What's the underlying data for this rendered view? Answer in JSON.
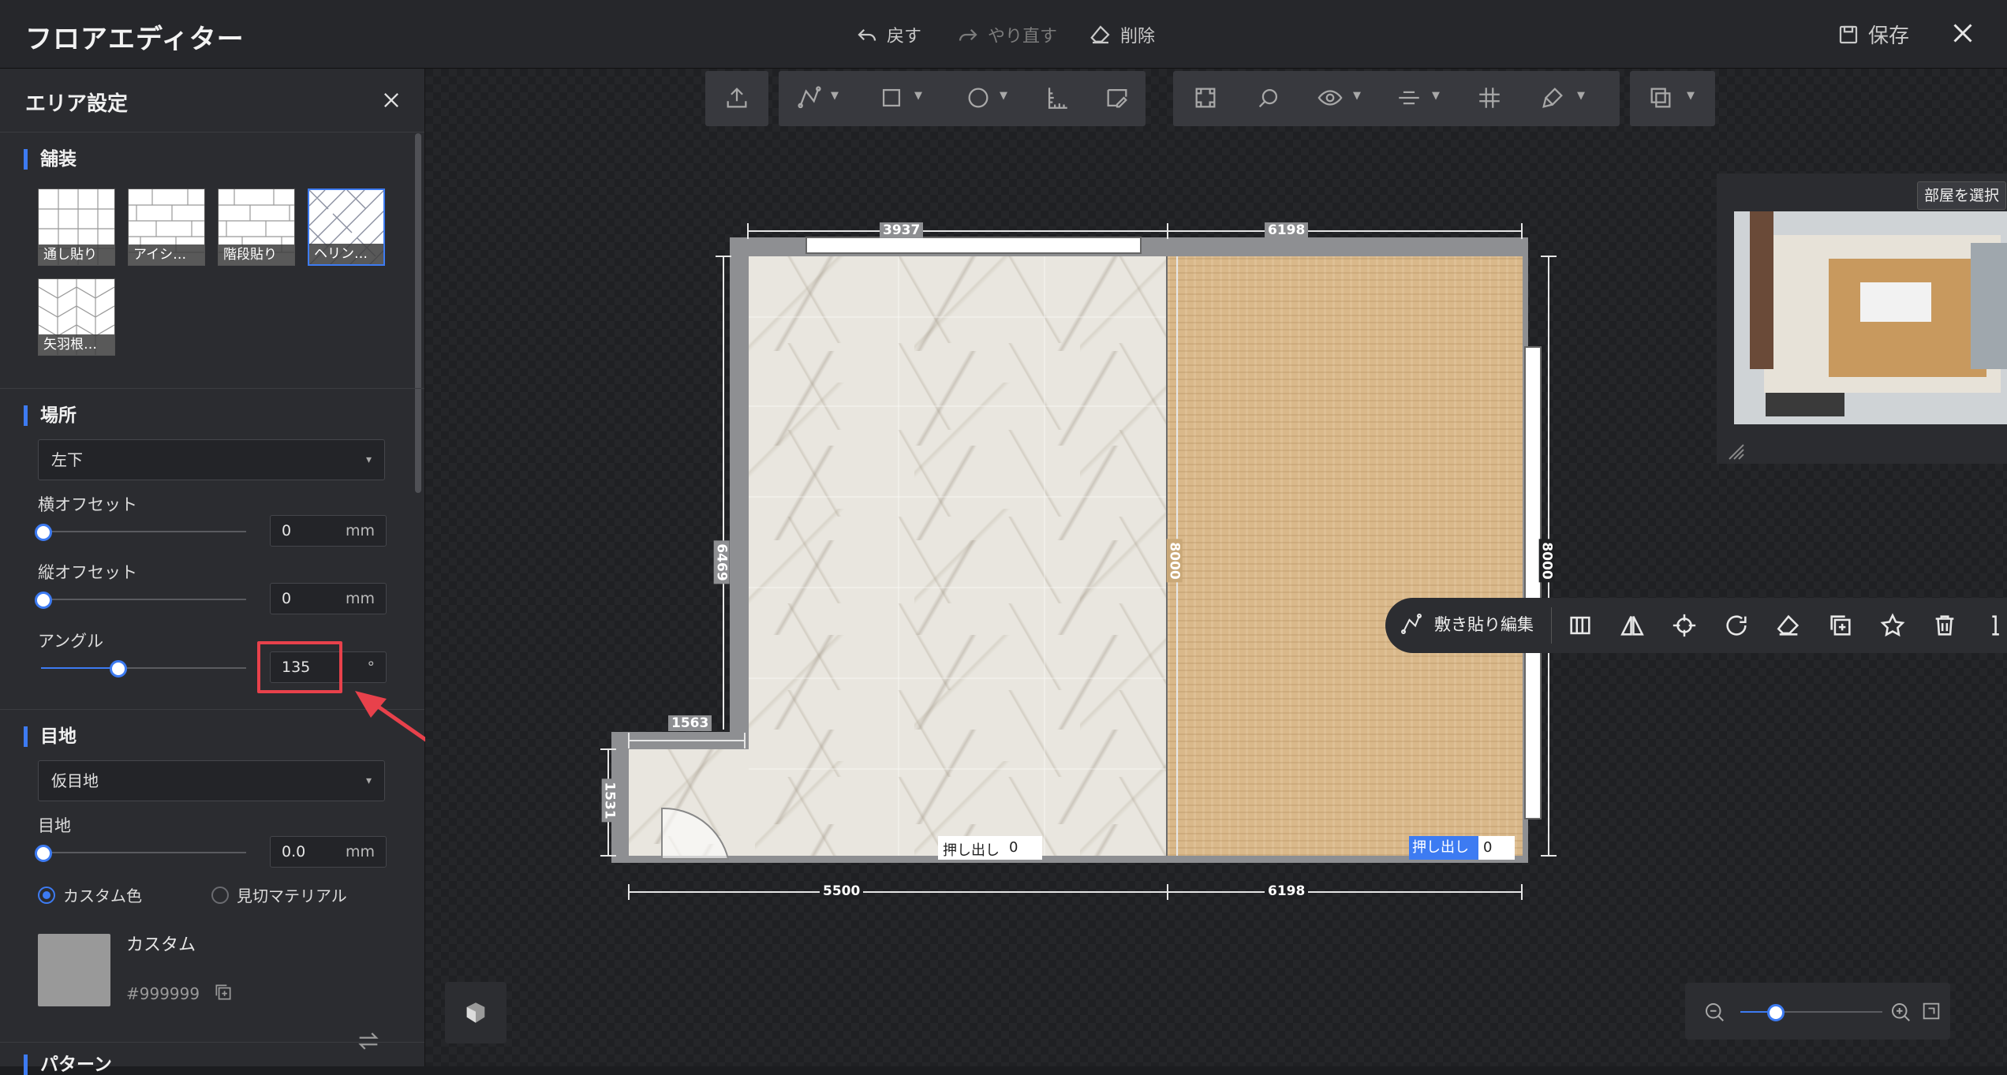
{
  "app": {
    "title": "フロアエディター"
  },
  "topbar": {
    "undo_label": "戻す",
    "redo_label": "やり直す",
    "delete_label": "削除",
    "save_label": "保存"
  },
  "panel": {
    "title": "エリア設定",
    "paving": {
      "section_title": "舗装",
      "patterns": [
        {
          "label": "通し貼り",
          "selected": false
        },
        {
          "label": "アイシ…",
          "selected": false
        },
        {
          "label": "階段貼り",
          "selected": false
        },
        {
          "label": "ヘリン…",
          "selected": true
        },
        {
          "label": "矢羽根…",
          "selected": false
        }
      ]
    },
    "location": {
      "section_title": "場所",
      "anchor_value": "左下",
      "h_offset_label": "横オフセット",
      "h_offset_value": "0",
      "h_offset_unit": "mm",
      "v_offset_label": "縦オフセット",
      "v_offset_value": "0",
      "v_offset_unit": "mm",
      "angle_label": "アングル",
      "angle_value": "135",
      "angle_unit": "°",
      "angle_fraction": 0.375
    },
    "joint": {
      "section_title": "目地",
      "type_value": "仮目地",
      "width_label": "目地",
      "width_value": "0.0",
      "width_unit": "mm",
      "color_mode_custom": "カスタム色",
      "color_mode_material": "見切マテリアル",
      "selected_mode": "custom",
      "swatch_name": "カスタム",
      "swatch_hex": "#999999"
    },
    "next_section_title": "パターン"
  },
  "canvas": {
    "tile_edit_label": "敷き貼り編集",
    "select_room_label": "部屋を選択",
    "extrude_label": "押し出し",
    "extrude_left_value": "0",
    "extrude_right_value": "0",
    "zoom_fraction": 0.25
  },
  "plan": {
    "dims": {
      "top_left": "3937",
      "top_right": "6198",
      "left_vertical": "6469",
      "middle_vertical": "8000",
      "right_vertical": "8000",
      "notch_width": "1563",
      "notch_height": "1531",
      "bottom_left": "5500",
      "bottom_right": "6198"
    }
  },
  "colors": {
    "accent": "#3d7bf2",
    "highlight": "#e8414b"
  }
}
